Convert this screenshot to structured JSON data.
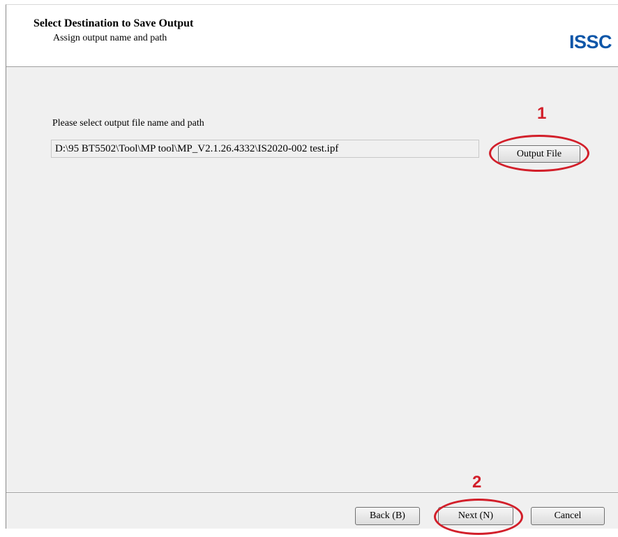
{
  "header": {
    "title": "Select Destination to Save Output",
    "subtitle": "Assign output name and path",
    "logo_text": "ISSC",
    "logo_color": "#0e56a8"
  },
  "main": {
    "prompt_label": "Please select output file name and path",
    "output_path_value": "D:\\95 BT5502\\Tool\\MP tool\\MP_V2.1.26.4332\\IS2020-002 test.ipf",
    "output_file_button_label": "Output File"
  },
  "footer": {
    "back_label": "Back (B)",
    "next_label": "Next (N)",
    "cancel_label": "Cancel"
  },
  "annotations": {
    "step_1": "1",
    "step_2": "2",
    "color": "#d21f2a"
  }
}
